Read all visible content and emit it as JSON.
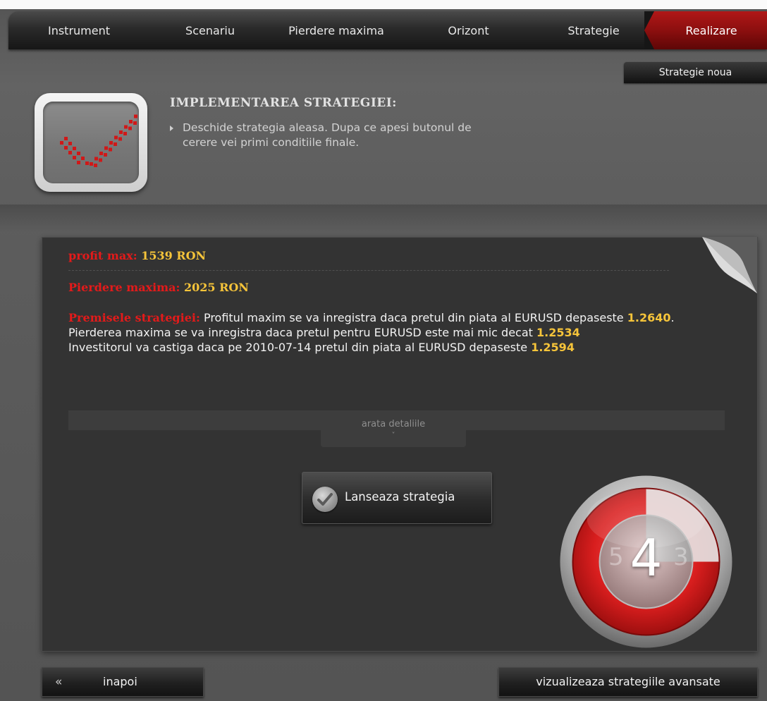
{
  "nav": {
    "steps": [
      {
        "label": "Instrument",
        "active": false
      },
      {
        "label": "Scenariu",
        "active": false
      },
      {
        "label": "Pierdere maxima",
        "active": false
      },
      {
        "label": "Orizont",
        "active": false
      },
      {
        "label": "Strategie",
        "active": false
      },
      {
        "label": "Realizare",
        "active": true
      }
    ],
    "new_strategy_label": "Strategie noua"
  },
  "hint": {
    "icon": "checkmark-icon",
    "title": "IMPLEMENTAREA STRATEGIEI:",
    "text": "Deschide strategia aleasa. Dupa ce apesi butonul de cerere vei primi conditiile finale."
  },
  "summary": {
    "profit_label": "profit max:",
    "profit_value": "1539 RON",
    "loss_label": "Pierdere maxima:",
    "loss_value": "2025 RON",
    "premise_label": "Premisele strategiei:",
    "premise_text_1": " Profitul maxim se va inregistra daca pretul din piata al EURUSD depaseste ",
    "premise_value_1": "1.2640",
    "premise_text_2": ". Pierderea maxima se va inregistra daca pretul pentru EURUSD este mai mic decat ",
    "premise_value_2": "1.2534",
    "premise_text_3": "Investitorul va castiga daca pe 2010-07-14 pretul din piata al EURUSD depaseste ",
    "premise_value_3": "1.2594"
  },
  "details": {
    "label": "arata detaliile",
    "chevron": "˅"
  },
  "launch": {
    "label": "Lanseaza strategia",
    "icon": "check-circle-icon"
  },
  "timer": {
    "current": "4",
    "previous": "5",
    "next": "3",
    "elapsed_fraction": 0.25
  },
  "footer": {
    "back_icon": "«",
    "back_label": "inapoi",
    "advanced_label": "vizualizeaza strategiile avansate"
  },
  "colors": {
    "accent_red": "#e41a1a",
    "value_yellow": "#f6c43a",
    "active_step": "#8c0f0f"
  }
}
